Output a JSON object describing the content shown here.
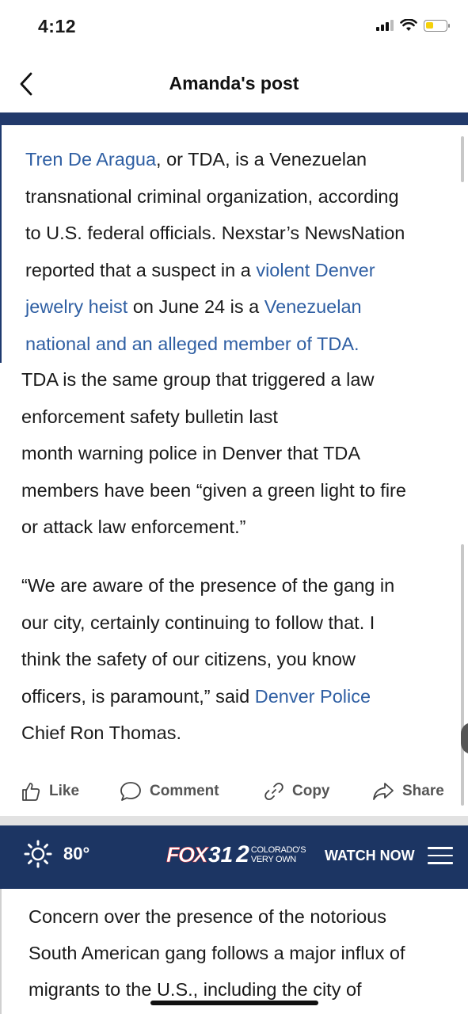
{
  "status_bar": {
    "time": "4:12"
  },
  "nav": {
    "title": "Amanda's post",
    "back_icon": "chevron-left-icon"
  },
  "article": {
    "para1": {
      "l1_link": "Tren De Aragua",
      "l1_text": ", or TDA, is a Venezuelan",
      "l2": "transnational criminal organization, according",
      "l3": "to U.S. federal officials. Nexstar’s NewsNation",
      "l4_text": "reported that a suspect in a ",
      "l4_link": "violent Denver",
      "l5_link": "jewelry heist",
      "l5_text": " on June 24 is a ",
      "l5_link2": "Venezuelan",
      "l6_link": "national and an alleged member of TDA."
    },
    "para2": {
      "l1": "TDA is the same group that triggered a law",
      "l2": "enforcement safety bulletin last",
      "l3": "month warning police in Denver that TDA",
      "l4": "members have been “given a green light to fire",
      "l5": "or attack law enforcement.”"
    },
    "para3": {
      "l1": "“We are aware of the presence of the gang in",
      "l2": "our city, certainly continuing to follow that. I",
      "l3": "think the safety of our citizens, you know",
      "l4_text": "officers, is paramount,” said ",
      "l4_link": "Denver Police",
      "l5": "Chief Ron Thomas."
    }
  },
  "actions": {
    "like": "Like",
    "comment": "Comment",
    "copy": "Copy",
    "share": "Share"
  },
  "ad_bar": {
    "temperature": "80°",
    "weather_icon": "sun-icon",
    "brand_fox": "FOX",
    "brand_num": "31",
    "brand_two": "2",
    "brand_tag1": "COLORADO'S",
    "brand_tag2": "VERY OWN",
    "watch_now": "WATCH NOW"
  },
  "article2": {
    "l1": "Concern over the presence of the notorious",
    "l2": "South American gang follows a major influx of",
    "l3": "migrants to the U.S., including the city of"
  },
  "colors": {
    "link": "#2f5fa3",
    "header_blue": "#223a6b",
    "ad_blue": "#1c3563",
    "fox_red": "#e8222a"
  }
}
